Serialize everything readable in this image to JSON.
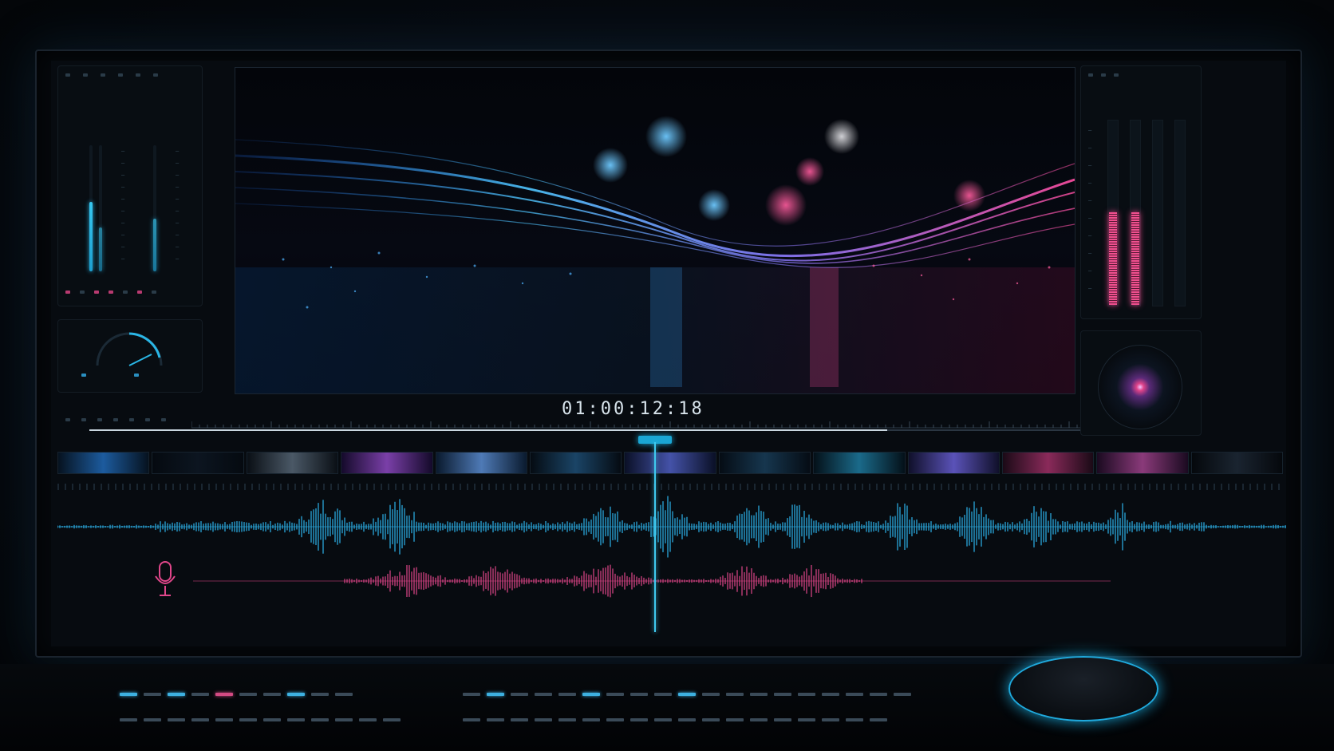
{
  "viewer": {
    "timecode": "01:00:12:18"
  },
  "colors": {
    "accent_cyan": "#29b8e6",
    "accent_pink": "#e0468a",
    "background": "#05080c"
  },
  "icons": {
    "microphone": "microphone-icon"
  }
}
